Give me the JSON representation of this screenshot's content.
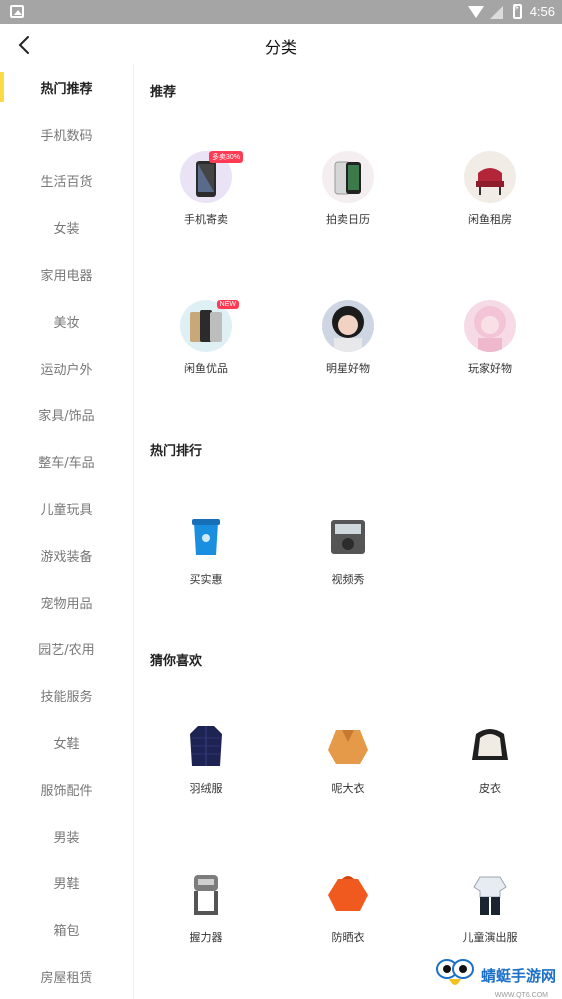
{
  "status_bar": {
    "time": "4:56"
  },
  "header": {
    "title": "分类"
  },
  "sidebar": {
    "items": [
      {
        "label": "热门推荐"
      },
      {
        "label": "手机数码"
      },
      {
        "label": "生活百货"
      },
      {
        "label": "女装"
      },
      {
        "label": "家用电器"
      },
      {
        "label": "美妆"
      },
      {
        "label": "运动户外"
      },
      {
        "label": "家具/饰品"
      },
      {
        "label": "整车/车品"
      },
      {
        "label": "儿童玩具"
      },
      {
        "label": "游戏装备"
      },
      {
        "label": "宠物用品"
      },
      {
        "label": "园艺/农用"
      },
      {
        "label": "技能服务"
      },
      {
        "label": "女鞋"
      },
      {
        "label": "服饰配件"
      },
      {
        "label": "男装"
      },
      {
        "label": "男鞋"
      },
      {
        "label": "箱包"
      },
      {
        "label": "房屋租赁"
      }
    ],
    "active_index": 0
  },
  "sections": {
    "recommend": {
      "title": "推荐",
      "items": [
        {
          "label": "手机寄卖",
          "icon": "phone-icon",
          "badge": "多卖30%"
        },
        {
          "label": "拍卖日历",
          "icon": "phone-icon"
        },
        {
          "label": "闲鱼租房",
          "icon": "chair-icon"
        },
        {
          "label": "闲鱼优品",
          "icon": "phone-icon",
          "badge": "NEW"
        },
        {
          "label": "明星好物",
          "icon": "avatar-icon"
        },
        {
          "label": "玩家好物",
          "icon": "avatar-icon"
        }
      ]
    },
    "hot_rank": {
      "title": "热门排行",
      "items": [
        {
          "label": "买实惠",
          "icon": "trash-bin-icon"
        },
        {
          "label": "视频秀",
          "icon": "device-icon"
        }
      ]
    },
    "guess": {
      "title": "猜你喜欢",
      "items": [
        {
          "label": "羽绒服",
          "icon": "jacket-icon"
        },
        {
          "label": "呢大衣",
          "icon": "coat-icon"
        },
        {
          "label": "皮衣",
          "icon": "leather-jacket-icon"
        },
        {
          "label": "握力器",
          "icon": "grip-icon"
        },
        {
          "label": "防晒衣",
          "icon": "sun-jacket-icon"
        },
        {
          "label": "儿童演出服",
          "icon": "kids-outfit-icon"
        }
      ]
    }
  },
  "watermark": {
    "text": "蜻蜓手游网",
    "sub": "WWW.QT6.COM"
  },
  "colors": {
    "accent": "#ffda44",
    "status_bar": "#a5a5a5",
    "badge": "#ff3b53"
  }
}
